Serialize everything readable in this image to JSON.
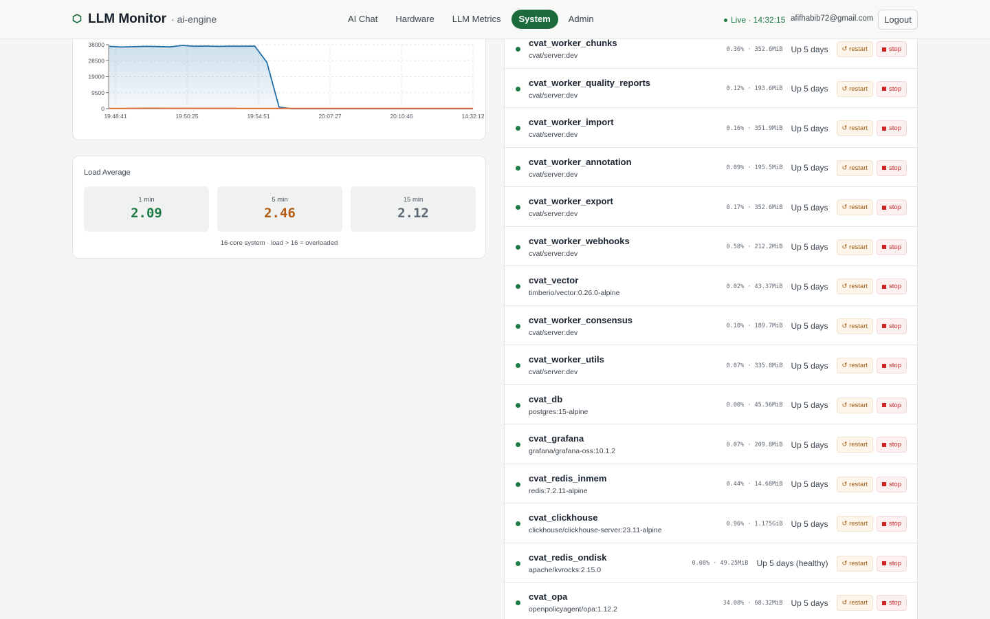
{
  "header": {
    "title": "LLM Monitor",
    "subtitle": "· ai-engine",
    "brand_color": "#1d6a3c",
    "nav": [
      {
        "label": "AI Chat",
        "active": false
      },
      {
        "label": "Hardware",
        "active": false
      },
      {
        "label": "LLM Metrics",
        "active": false
      },
      {
        "label": "System",
        "active": true
      },
      {
        "label": "Admin",
        "active": false
      }
    ],
    "live_status": "Live · 14:32:15",
    "user_email": "afifhabib72@gmail.com",
    "logout_label": "Logout"
  },
  "chart_data": {
    "type": "line",
    "title": "",
    "xlabel": "",
    "ylabel": "",
    "x_ticks": [
      "19:48:41",
      "19:50:25",
      "19:54:51",
      "20:07:27",
      "20:10:46",
      "14:32:12"
    ],
    "y_ticks": [
      0,
      9500,
      19000,
      28500,
      38000
    ],
    "ylim": [
      0,
      38000
    ],
    "grid": true,
    "legend": "none",
    "series": [
      {
        "color": "#1f6fa8",
        "fill": true,
        "values": [
          37000,
          36600,
          36800,
          37000,
          36900,
          36700,
          37600,
          37100,
          37200,
          37000,
          37100,
          37100,
          37200,
          27500,
          1000,
          0,
          0,
          0,
          0,
          0,
          0,
          0,
          0,
          0,
          0,
          0,
          0,
          0,
          0,
          0,
          0
        ]
      },
      {
        "color": "#e0642a",
        "fill": false,
        "values": [
          150,
          180,
          200,
          260,
          240,
          220,
          210,
          200,
          200,
          190,
          190,
          180,
          170,
          160,
          150,
          150,
          150,
          150,
          150,
          150,
          150,
          150,
          150,
          150,
          150,
          150,
          150,
          150,
          150,
          150,
          150
        ]
      }
    ]
  },
  "load": {
    "title": "Load Average",
    "items": [
      {
        "label": "1 min",
        "value": "2.09",
        "color": "#1e7a44"
      },
      {
        "label": "5 min",
        "value": "2.46",
        "color": "#b05a12"
      },
      {
        "label": "15 min",
        "value": "2.12",
        "color": "#5c6a78"
      }
    ],
    "note": "16-core system · load > 16 = overloaded"
  },
  "containers": [
    {
      "name": "cvat_worker_chunks",
      "image": "cvat/server:dev",
      "stats": "0.36% · 352.6MiB",
      "status": "Up 5 days"
    },
    {
      "name": "cvat_worker_quality_reports",
      "image": "cvat/server:dev",
      "stats": "0.12% · 193.6MiB",
      "status": "Up 5 days"
    },
    {
      "name": "cvat_worker_import",
      "image": "cvat/server:dev",
      "stats": "0.16% · 351.9MiB",
      "status": "Up 5 days"
    },
    {
      "name": "cvat_worker_annotation",
      "image": "cvat/server:dev",
      "stats": "0.09% · 195.5MiB",
      "status": "Up 5 days"
    },
    {
      "name": "cvat_worker_export",
      "image": "cvat/server:dev",
      "stats": "0.17% · 352.6MiB",
      "status": "Up 5 days"
    },
    {
      "name": "cvat_worker_webhooks",
      "image": "cvat/server:dev",
      "stats": "0.58% · 212.2MiB",
      "status": "Up 5 days"
    },
    {
      "name": "cvat_vector",
      "image": "timberio/vector:0.26.0-alpine",
      "stats": "0.02% · 43.37MiB",
      "status": "Up 5 days"
    },
    {
      "name": "cvat_worker_consensus",
      "image": "cvat/server:dev",
      "stats": "0.10% · 189.7MiB",
      "status": "Up 5 days"
    },
    {
      "name": "cvat_worker_utils",
      "image": "cvat/server:dev",
      "stats": "0.07% · 335.8MiB",
      "status": "Up 5 days"
    },
    {
      "name": "cvat_db",
      "image": "postgres:15-alpine",
      "stats": "0.00% · 45.56MiB",
      "status": "Up 5 days"
    },
    {
      "name": "cvat_grafana",
      "image": "grafana/grafana-oss:10.1.2",
      "stats": "0.07% · 209.8MiB",
      "status": "Up 5 days"
    },
    {
      "name": "cvat_redis_inmem",
      "image": "redis:7.2.11-alpine",
      "stats": "0.44% · 14.68MiB",
      "status": "Up 5 days"
    },
    {
      "name": "cvat_clickhouse",
      "image": "clickhouse/clickhouse-server:23.11-alpine",
      "stats": "0.96% · 1.175GiB",
      "status": "Up 5 days"
    },
    {
      "name": "cvat_redis_ondisk",
      "image": "apache/kvrocks:2.15.0",
      "stats": "0.08% · 49.25MiB",
      "status": "Up 5 days (healthy)"
    },
    {
      "name": "cvat_opa",
      "image": "openpolicyagent/opa:1.12.2",
      "stats": "34.08% · 68.32MiB",
      "status": "Up 5 days"
    }
  ],
  "actions": {
    "restart_label": "↺ restart",
    "stop_label": "stop"
  }
}
